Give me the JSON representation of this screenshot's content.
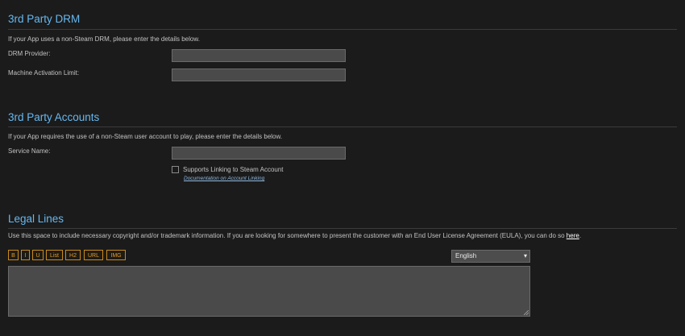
{
  "drm": {
    "title": "3rd Party DRM",
    "description": "If your App uses a non-Steam DRM, please enter the details below.",
    "provider_label": "DRM Provider:",
    "provider_value": "",
    "activation_label": "Machine Activation Limit:",
    "activation_value": ""
  },
  "accounts": {
    "title": "3rd Party Accounts",
    "description": "If your App requires the use of a non-Steam user account to play, please enter the details below.",
    "service_label": "Service Name:",
    "service_value": "",
    "linking_checkbox_label": "Supports Linking to Steam Account",
    "linking_checked": false,
    "doc_link": "Documentation on Account Linking"
  },
  "legal": {
    "title": "Legal Lines",
    "description": "Use this space to include necessary copyright and/or trademark information. If you are looking for somewhere to present the customer with an End User License Agreement (EULA), you can do so ",
    "here_link": "here",
    "description_end": ".",
    "format_buttons": [
      "B",
      "I",
      "U",
      "List",
      "H2",
      "URL",
      "IMG"
    ],
    "language_selected": "English",
    "text_value": ""
  },
  "colors": {
    "background": "#1b1b1b",
    "heading": "#66b8f0",
    "format_button": "#e09b2a"
  }
}
